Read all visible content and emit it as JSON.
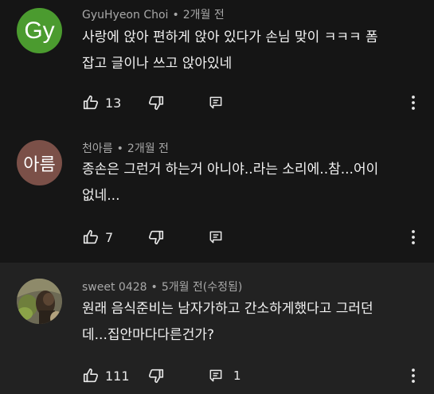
{
  "comments": [
    {
      "avatar_text": "Gy",
      "avatar_color": "#4b9b2f",
      "author": "GyuHyeon Choi",
      "time": "2개월 전",
      "line1": "사랑에 앉아 편하게 앉아 있다가 손님 맞이 ㅋㅋㅋ 폼",
      "line2": "잡고 글이나 쓰고 앉아있네",
      "likes": "13",
      "replies": ""
    },
    {
      "avatar_text": "아름",
      "avatar_color": "#7b5048",
      "author": "천아름",
      "time": "2개월 전",
      "line1": "종손은 그런거 하는거 아니야..라는 소리에..참...어이",
      "line2": "없네...",
      "likes": "7",
      "replies": ""
    },
    {
      "avatar_text": "",
      "avatar_color": "#4a4538",
      "author": "sweet 0428",
      "time": "5개월 전(수정됨)",
      "line1": "원래 음식준비는 남자가하고 간소하게했다고 그러던",
      "line2": "데...집안마다다른건가?",
      "likes": "111",
      "replies": "1"
    }
  ],
  "icons": {
    "like": "thumbs-up-icon",
    "dislike": "thumbs-down-icon",
    "reply": "reply-icon",
    "more": "more-vertical-icon"
  }
}
